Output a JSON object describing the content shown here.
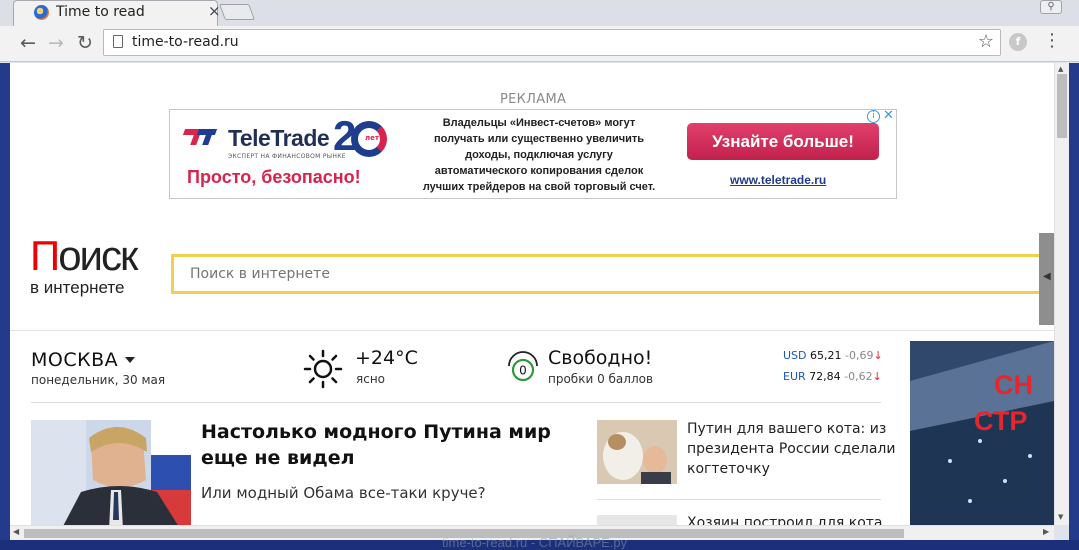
{
  "browser": {
    "tab_title": "Time to read",
    "url": "time-to-read.ru",
    "profile_label": "⚲"
  },
  "ad": {
    "label": "РЕКЛАМА",
    "brand": "TeleTrade",
    "brand_sub": "ЭКСПЕРТ НА ФИНАНСОВОМ РЫНКЕ",
    "anniversary": "2",
    "anniversary_unit": "лет",
    "slogan": "Просто, безопасно!",
    "text_lines": [
      "Владельцы «Инвест-счетов» могут",
      "получать или существенно увеличить",
      "доходы, подключая услугу",
      "автоматического копирования сделок",
      "лучших трейдеров на свой торговый счет."
    ],
    "cta": "Узнайте больше!",
    "link": "www.teletrade.ru"
  },
  "search": {
    "logo_first_letter": "П",
    "logo_rest": "оиск",
    "logo_sub": "в интернете",
    "placeholder": "Поиск в интернете"
  },
  "weather": {
    "city": "МОСКВА",
    "date": "понедельник, 30 мая",
    "temp": "+24°C",
    "condition": "ясно"
  },
  "traffic": {
    "score": "0",
    "title": "Свободно!",
    "subtitle": "пробки 0 баллов"
  },
  "currency": [
    {
      "code": "USD",
      "value": "65,21",
      "change": "-0,69",
      "arrow": "↓"
    },
    {
      "code": "EUR",
      "value": "72,84",
      "change": "-0,62",
      "arrow": "↓"
    }
  ],
  "news": {
    "main_title": "Настолько модного Путина мир еще не видел",
    "main_sub": "Или модный Обама все-таки круче?",
    "side": [
      {
        "title": "Путин для вашего кота: из президента России сделали когтеточку"
      },
      {
        "title": "Хозяин построил для кота"
      }
    ]
  },
  "banner_right": {
    "line1": "СН",
    "line2": "СТР"
  },
  "watermark": "time-to-read.ru - СПАЙВАРЕ.ру",
  "colors": {
    "ad_red": "#d8234d",
    "brand_blue": "#1e3d8f",
    "search_border": "#f1cf4f",
    "logo_red": "#e00"
  }
}
